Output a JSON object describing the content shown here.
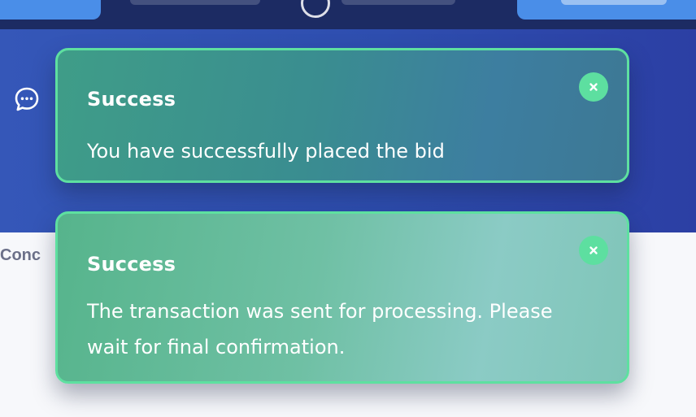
{
  "page": {
    "side_label": "Conc"
  },
  "toasts": [
    {
      "title": "Success",
      "message": "You have successfully placed the bid",
      "close_icon": "close-icon",
      "border_color": "#5ee0a0"
    },
    {
      "title": "Success",
      "message": "The transaction was sent for processing. Please wait for final confirmation.",
      "close_icon": "close-icon",
      "border_color": "#5ee0a0"
    }
  ],
  "icons": {
    "chat": "chat-bubble-icon"
  },
  "colors": {
    "nav_bg": "#1c2b63",
    "banner_bg": "#3050b0",
    "nav_button": "#4a8ee8",
    "success_accent": "#5ddfa0"
  }
}
